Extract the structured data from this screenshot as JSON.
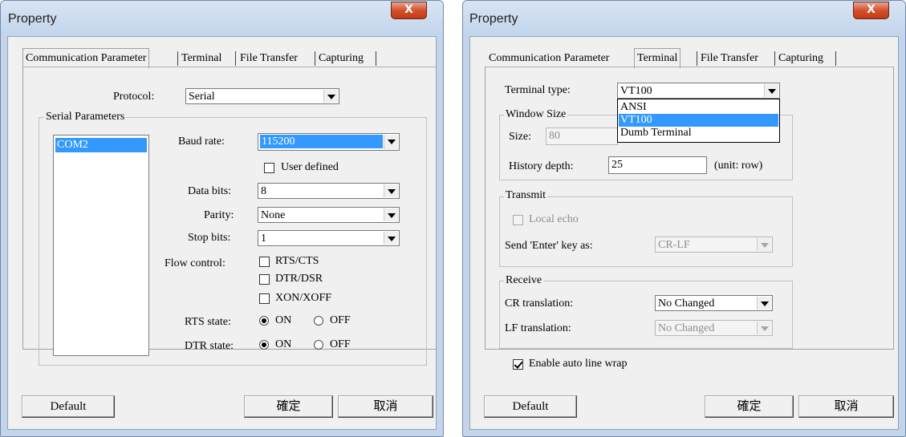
{
  "win1": {
    "title": "Property",
    "close_label": "X",
    "tabs": [
      "Communication Parameter",
      "Terminal",
      "File Transfer",
      "Capturing"
    ],
    "protocol_label": "Protocol:",
    "protocol_value": "Serial",
    "serial_group": "Serial Parameters",
    "ports": [
      "COM2"
    ],
    "baud_label": "Baud rate:",
    "baud_value": "115200",
    "user_defined_label": "User defined",
    "databits_label": "Data bits:",
    "databits_value": "8",
    "parity_label": "Parity:",
    "parity_value": "None",
    "stopbits_label": "Stop bits:",
    "stopbits_value": "1",
    "flow_label": "Flow control:",
    "flow_options": [
      "RTS/CTS",
      "DTR/DSR",
      "XON/XOFF"
    ],
    "rts_label": "RTS state:",
    "dtr_label": "DTR state:",
    "on_label": "ON",
    "off_label": "OFF",
    "default_button": "Default",
    "ok_button": "確定",
    "cancel_button": "取消"
  },
  "win2": {
    "title": "Property",
    "close_label": "X",
    "tabs": [
      "Communication Parameter",
      "Terminal",
      "File Transfer",
      "Capturing"
    ],
    "terminal_type_label": "Terminal type:",
    "terminal_type_value": "VT100",
    "terminal_type_options": [
      "ANSI",
      "VT100",
      "Dumb Terminal"
    ],
    "window_size_group": "Window Size",
    "size_label": "Size:",
    "size_value": "80",
    "history_label": "History depth:",
    "history_value": "25",
    "history_unit": "(unit: row)",
    "transmit_group": "Transmit",
    "local_echo_label": "Local echo",
    "send_enter_label": "Send 'Enter' key  as:",
    "send_enter_value": "CR-LF",
    "receive_group": "Receive",
    "cr_label": "CR translation:",
    "cr_value": "No Changed",
    "lf_label": "LF translation:",
    "lf_value": "No Changed",
    "autowrap_label": "Enable auto line wrap",
    "default_button": "Default",
    "ok_button": "確定",
    "cancel_button": "取消"
  }
}
